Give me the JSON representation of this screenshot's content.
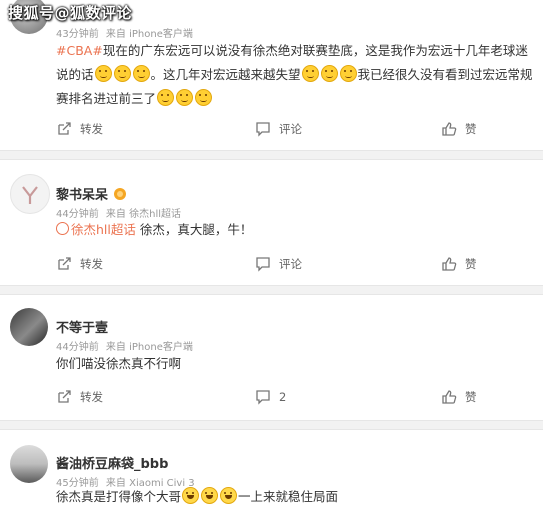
{
  "watermark": "搜狐号@狐数评论",
  "actions": {
    "share": "转发",
    "comment": "评论",
    "like": "赞"
  },
  "posts": [
    {
      "name": "",
      "time": "43分钟前",
      "source": "来自 iPhone客户端",
      "tag": "#CBA#",
      "text1": "现在的广东宏远可以说没有徐杰绝对联赛垫底，这是我作为宏远十几年老球迷说的话",
      "text2": "。这几年对宏远越来越失望",
      "text3": "我已经很久没有看到过宏远常规赛排名进过前三了",
      "comment_count": ""
    },
    {
      "name": "黎书呆呆",
      "time": "44分钟前",
      "source": "来自 徐杰hll超话",
      "topic": "徐杰hll超话",
      "text": " 徐杰，真大腿，牛！",
      "comment_count": ""
    },
    {
      "name": "不等于壹",
      "time": "44分钟前",
      "source": "来自 iPhone客户端",
      "text": "你们喵没徐杰真不行啊",
      "comment_count": "2"
    },
    {
      "name": "酱油桥豆麻袋_bbb",
      "time": "45分钟前",
      "source": "来自 Xiaomi Civi 3",
      "text1": "徐杰真是打得像个大哥",
      "text2": "一上来就稳住局面"
    }
  ],
  "icons": {
    "share": "share-icon",
    "comment": "comment-icon",
    "like": "thumbs-up-icon"
  }
}
